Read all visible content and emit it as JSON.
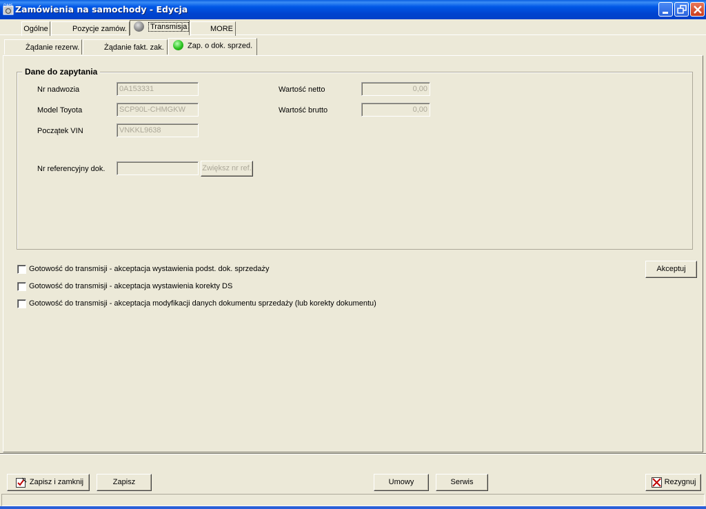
{
  "window": {
    "title": "Zamówienia na samochody - Edycja",
    "icon": "dms-app-icon"
  },
  "tabs": [
    {
      "label": "Ogólne",
      "active": false
    },
    {
      "label": "Pozycje zamów.",
      "active": false
    },
    {
      "label": "Transmisja",
      "active": true,
      "indicator": "gray"
    },
    {
      "label": "MORE",
      "active": false
    }
  ],
  "subtabs": [
    {
      "label": "Żądanie rezerw.",
      "active": false
    },
    {
      "label": "Żądanie fakt. zak.",
      "active": false
    },
    {
      "label": "Zap. o dok. sprzed.",
      "active": true,
      "indicator": "green"
    }
  ],
  "group": {
    "title": "Dane do zapytania",
    "fields": {
      "nr_nadwozia": {
        "label": "Nr nadwozia",
        "value": "0A153331"
      },
      "model_toyota": {
        "label": "Model Toyota",
        "value": "SCP90L-CHMGKW"
      },
      "poczatek_vin": {
        "label": "Początek VIN",
        "value": "VNKKL9638"
      },
      "wartosc_netto": {
        "label": "Wartość netto",
        "value": "0,00"
      },
      "wartosc_brutto": {
        "label": "Wartość brutto",
        "value": "0,00"
      },
      "nr_referencyjny": {
        "label": "Nr referencyjny dok.",
        "value": ""
      }
    },
    "increase_ref_button": "Zwiększ nr ref."
  },
  "checkboxes": [
    {
      "label": "Gotowość do transmisji - akceptacja wystawienia podst. dok. sprzedaży",
      "checked": false
    },
    {
      "label": "Gotowość do transmisji - akceptacja wystawienia korekty DS",
      "checked": false
    },
    {
      "label": "Gotowość do transmisji - akceptacja modyfikacji danych dokumentu sprzedaży (lub korekty dokumentu)",
      "checked": false
    }
  ],
  "accept_button": "Akceptuj",
  "footer": {
    "save_close": "Zapisz i zamknij",
    "save": "Zapisz",
    "contracts": "Umowy",
    "service": "Serwis",
    "cancel": "Rezygnuj"
  },
  "colors": {
    "titlebar": "#0054e3",
    "face": "#ece9d8",
    "led_gray": "#8c8c8c",
    "led_green": "#2ac21e"
  }
}
